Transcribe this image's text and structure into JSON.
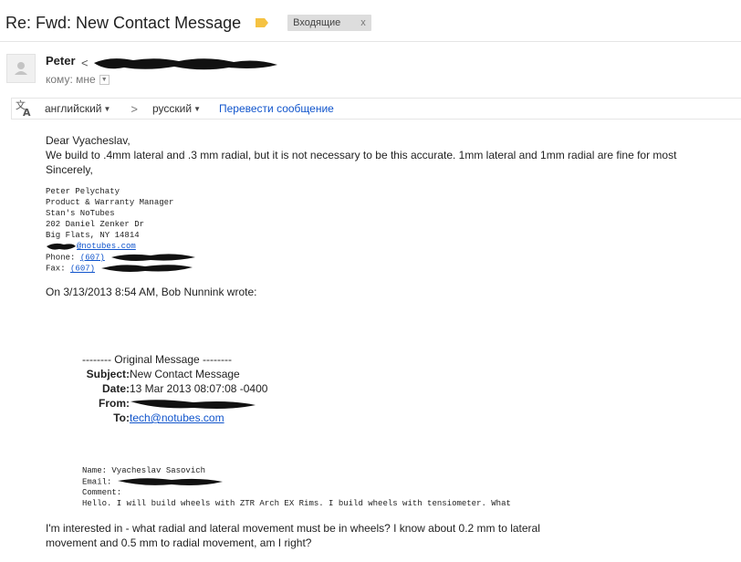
{
  "subject": "Re: Fwd: New Contact Message",
  "label_color": "#f5c242",
  "inbox_chip": {
    "label": "Входящие",
    "close": "x"
  },
  "sender": {
    "name": "Peter",
    "email_prefix": "<",
    "recipient_label": "кому: мне"
  },
  "translate": {
    "source_lang": "английский",
    "target_lang": "русский",
    "arrow": ">",
    "link": "Перевести сообщение"
  },
  "body": {
    "greeting": "Dear Vyacheslav,",
    "line1": "We build to .4mm lateral and .3 mm radial, but it is not necessary to be this accurate. 1mm lateral and 1mm radial are fine for most",
    "closing": "Sincerely,",
    "signature": [
      "Peter Pelychaty",
      "Product & Warranty Manager",
      "Stan's NoTubes",
      "202 Daniel Zenker Dr",
      "Big Flats, NY 14814"
    ],
    "sig_email_domain": "@notubes.com",
    "sig_phone_label": "Phone:",
    "sig_phone_prefix": "(607)",
    "sig_fax_label": "Fax:",
    "sig_fax_prefix": "(607)",
    "quote_intro": "On 3/13/2013 8:54 AM, Bob Nunnink wrote:"
  },
  "original": {
    "separator": "-------- Original Message --------",
    "subject_key": "Subject:",
    "subject_val": "New Contact Message",
    "date_key": "Date:",
    "date_val": "13 Mar 2013 08:07:08 -0400",
    "from_key": "From:",
    "to_key": "To:",
    "to_val": "tech@notubes.com"
  },
  "form": {
    "name_line": "Name: Vyacheslav Sasovich",
    "email_label": "Email:",
    "comment_label": "Comment:",
    "comment_text": "Hello. I will build wheels with ZTR Arch EX Rims. I build wheels with tensiometer. What"
  },
  "question": {
    "line1": "I'm interested in - what radial and lateral movement must be in wheels? I know about 0.2 mm to lateral",
    "line2": "movement and 0.5 mm to radial movement, am I right?"
  }
}
